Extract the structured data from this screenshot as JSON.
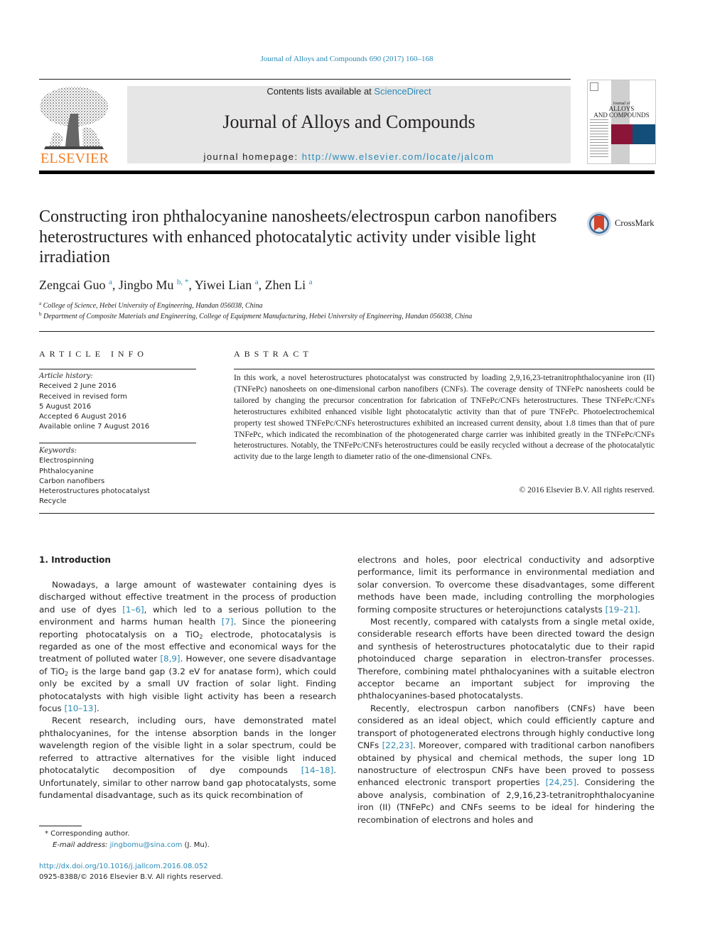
{
  "header": {
    "citation": "Journal of Alloys and Compounds 690 (2017) 160–168",
    "contents_prefix": "Contents lists available at ",
    "contents_link": "ScienceDirect",
    "journal_name": "Journal of Alloys and Compounds",
    "homepage_prefix": "journal homepage: ",
    "homepage_url": "http://www.elsevier.com/locate/jalcom",
    "publisher": "ELSEVIER",
    "cover": {
      "title_line1": "Journal of",
      "title_line2": "ALLOYS",
      "title_line3": "AND COMPOUNDS",
      "colors": [
        "#8a1538",
        "#124e78"
      ]
    },
    "crossmark_label": "CrossMark"
  },
  "article": {
    "title": "Constructing iron phthalocyanine nanosheets/electrospun carbon nanofibers heterostructures with enhanced photocatalytic activity under visible light irradiation",
    "authors": [
      {
        "name": "Zengcai Guo",
        "sup": "a"
      },
      {
        "name": "Jingbo Mu",
        "sup": "b, *"
      },
      {
        "name": "Yiwei Lian",
        "sup": "a"
      },
      {
        "name": "Zhen Li",
        "sup": "a"
      }
    ],
    "affiliations": [
      {
        "sup": "a",
        "text": "College of Science, Hebei University of Engineering, Handan 056038, China"
      },
      {
        "sup": "b",
        "text": "Department of Composite Materials and Engineering, College of Equipment Manufacturing, Hebei University of Engineering, Handan 056038, China"
      }
    ]
  },
  "article_info": {
    "heading": "ARTICLE INFO",
    "history_label": "Article history:",
    "history": [
      "Received 2 June 2016",
      "Received in revised form",
      "5 August 2016",
      "Accepted 6 August 2016",
      "Available online 7 August 2016"
    ],
    "keywords_label": "Keywords:",
    "keywords": [
      "Electrospinning",
      "Phthalocyanine",
      "Carbon nanofibers",
      "Heterostructures photocatalyst",
      "Recycle"
    ]
  },
  "abstract": {
    "heading": "ABSTRACT",
    "text": "In this work, a novel heterostructures photocatalyst was constructed by loading 2,9,16,23-tetranitrophthalocyanine iron (II) (TNFePc) nanosheets on one-dimensional carbon nanofibers (CNFs). The coverage density of TNFePc nanosheets could be tailored by changing the precursor concentration for fabrication of TNFePc/CNFs heterostructures. These TNFePc/CNFs heterostructures exhibited enhanced visible light photocatalytic activity than that of pure TNFePc. Photoelectrochemical property test showed TNFePc/CNFs heterostructures exhibited an increased current density, about 1.8 times than that of pure TNFePc, which indicated the recombination of the photogenerated charge carrier was inhibited greatly in the TNFePc/CNFs heterostructures. Notably, the TNFePc/CNFs heterostructures could be easily recycled without a decrease of the photocatalytic activity due to the large length to diameter ratio of the one-dimensional CNFs.",
    "copyright": "© 2016 Elsevier B.V. All rights reserved."
  },
  "introduction": {
    "heading": "1.  Introduction",
    "left": {
      "p1_a": "Nowadays, a large amount of wastewater containing dyes is discharged without effective treatment in the process of production and use of dyes ",
      "ref1": "[1–6]",
      "p1_b": ", which led to a serious pollution to the environment and harms human health ",
      "ref2": "[7]",
      "p1_c": ". Since the pioneering reporting photocatalysis on a TiO",
      "sub2": "2",
      "p1_d": " electrode, photocatalysis is regarded as one of the most effective and economical ways for the treatment of polluted water ",
      "ref3": "[8,9]",
      "p1_e": ". However, one severe disadvantage of TiO",
      "p1_f": " is the large band gap (3.2 eV for anatase form), which could only be excited by a small UV fraction of solar light. Finding photocatalysts with high visible light activity has been a research focus ",
      "ref4": "[10–13]",
      "p1_g": ".",
      "p2_a": "Recent research, including ours, have demonstrated matel phthalocyanines, for the intense absorption bands in the longer wavelength region of the visible light in a solar spectrum, could be referred to attractive alternatives for the visible light induced photocatalytic decomposition of dye compounds ",
      "ref5": "[14–18]",
      "p2_b": ". Unfortunately, similar to other narrow band gap photocatalysts, some fundamental disadvantage, such as its quick recombination of"
    },
    "right": {
      "p1_a": "electrons and holes, poor electrical conductivity and adsorptive performance, limit its performance in environmental mediation and solar conversion. To overcome these disadvantages, some different methods have been made, including controlling the morphologies forming composite structures or heterojunctions catalysts ",
      "ref1": "[19–21]",
      "p1_b": ".",
      "p2": "Most recently, compared with catalysts from a single metal oxide, considerable research efforts have been directed toward the design and synthesis of heterostructures photocatalytic due to their rapid photoinduced charge separation in electron-transfer processes. Therefore, combining matel phthalocyanines with a suitable electron acceptor became an important subject for improving the phthalocyanines-based photocatalysts.",
      "p3_a": "Recently, electrospun carbon nanofibers (CNFs) have been considered as an ideal object, which could efficiently capture and transport of photogenerated electrons through highly conductive long CNFs ",
      "ref2": "[22,23]",
      "p3_b": ". Moreover, compared with traditional carbon nanofibers obtained by physical and chemical methods, the super long 1D nanostructure of electrospun CNFs have been proved to possess enhanced electronic transport properties ",
      "ref3": "[24,25]",
      "p3_c": ". Considering the above analysis, combination of 2,9,16,23-tetranitrophthalocyanine iron (II) (TNFePc) and CNFs seems to be ideal for hindering the recombination of electrons and holes and"
    }
  },
  "footnotes": {
    "corresponding": "* Corresponding author.",
    "email_label": "E-mail address: ",
    "email": "jingbomu@sina.com",
    "email_suffix": " (J. Mu).",
    "doi_url": "http://dx.doi.org/10.1016/j.jallcom.2016.08.052",
    "issn_line": "0925-8388/© 2016 Elsevier B.V. All rights reserved."
  }
}
